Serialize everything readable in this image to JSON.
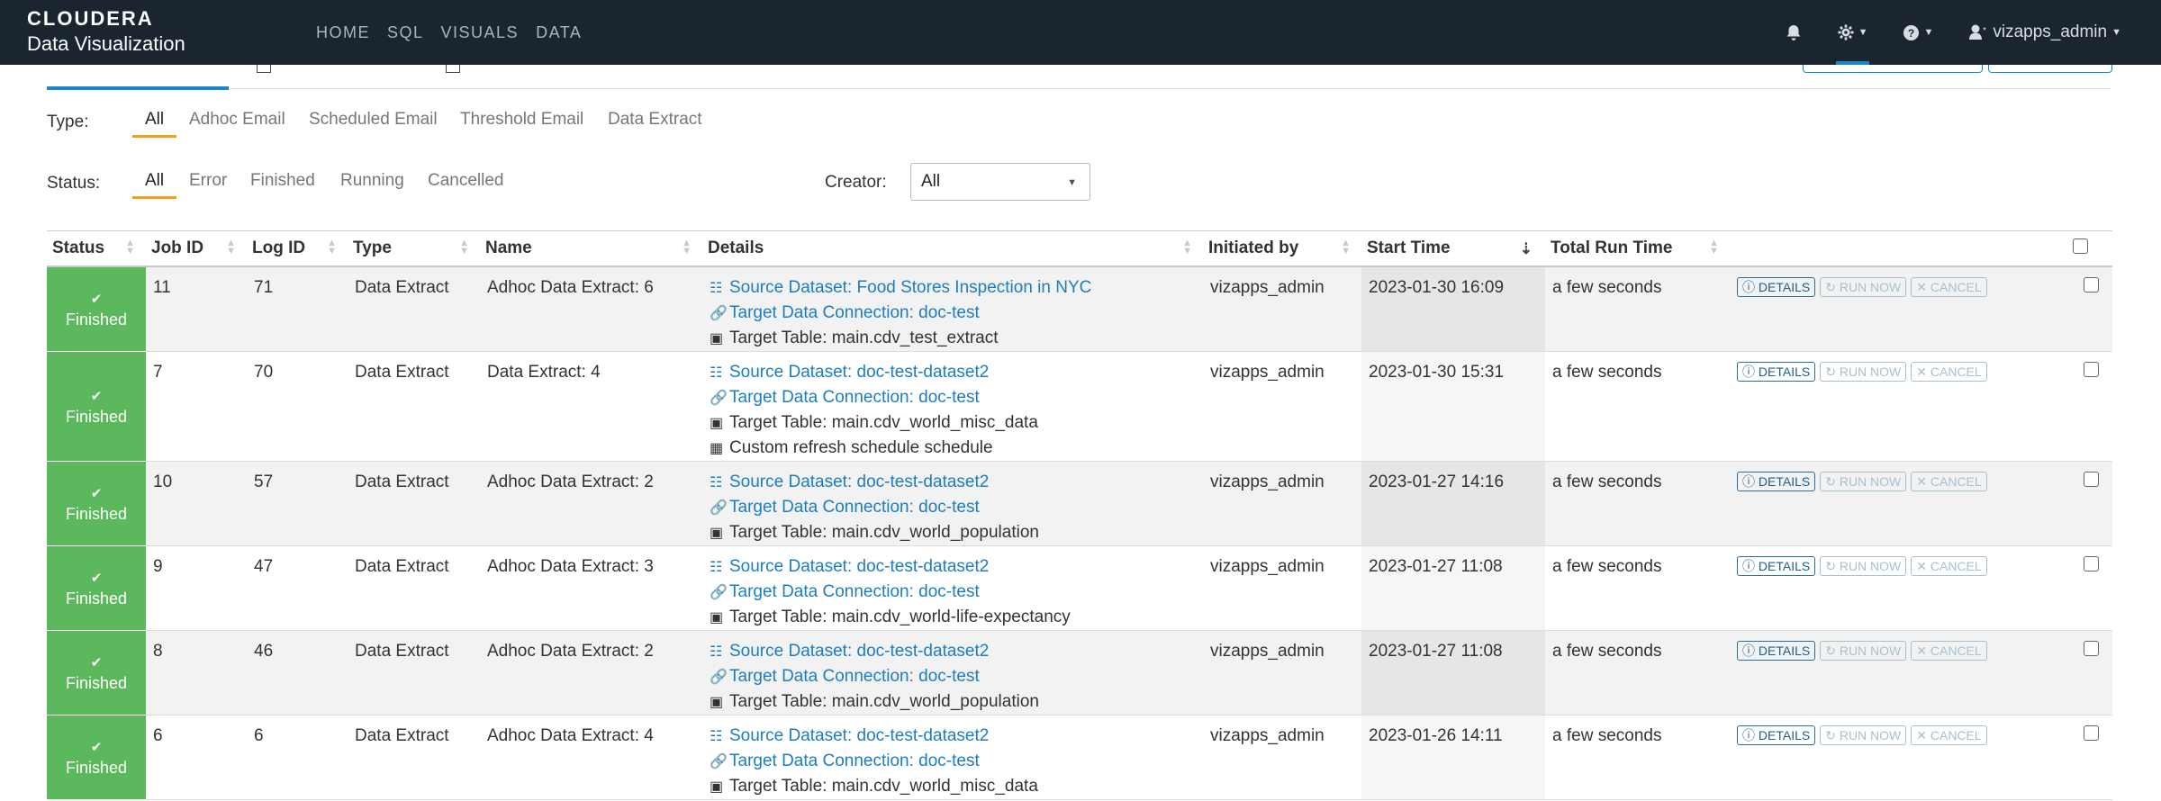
{
  "brand": {
    "top": "CLOUDERA",
    "bottom": "Data Visualization"
  },
  "nav": {
    "links": [
      "HOME",
      "SQL",
      "VISUALS",
      "DATA"
    ],
    "user": "vizapps_admin"
  },
  "filters": {
    "type_label": "Type:",
    "type_options": [
      "All",
      "Adhoc Email",
      "Scheduled Email",
      "Threshold Email",
      "Data Extract"
    ],
    "status_label": "Status:",
    "status_options": [
      "All",
      "Error",
      "Finished",
      "Running",
      "Cancelled"
    ],
    "creator_label": "Creator:",
    "creator_value": "All"
  },
  "table": {
    "headers": [
      "Status",
      "Job ID",
      "Log ID",
      "Type",
      "Name",
      "Details",
      "Initiated by",
      "Start Time",
      "Total Run Time"
    ],
    "buttons": {
      "details": "DETAILS",
      "run_now": "RUN NOW",
      "cancel": "CANCEL"
    },
    "rows": [
      {
        "status": "Finished",
        "job_id": "11",
        "log_id": "71",
        "type": "Data Extract",
        "name": "Adhoc Data Extract: 6",
        "source": "Source Dataset: Food Stores Inspection in NYC",
        "connection": "Target Data Connection: doc-test",
        "target": "Target Table: main.cdv_test_extract",
        "schedule": "",
        "initiated_by": "vizapps_admin",
        "start_time": "2023-01-30 16:09",
        "run_time": "a few seconds"
      },
      {
        "status": "Finished",
        "job_id": "7",
        "log_id": "70",
        "type": "Data Extract",
        "name": "Data Extract: 4",
        "source": "Source Dataset: doc-test-dataset2",
        "connection": "Target Data Connection: doc-test",
        "target": "Target Table: main.cdv_world_misc_data",
        "schedule": "Custom refresh schedule schedule",
        "initiated_by": "vizapps_admin",
        "start_time": "2023-01-30 15:31",
        "run_time": "a few seconds"
      },
      {
        "status": "Finished",
        "job_id": "10",
        "log_id": "57",
        "type": "Data Extract",
        "name": "Adhoc Data Extract: 2",
        "source": "Source Dataset: doc-test-dataset2",
        "connection": "Target Data Connection: doc-test",
        "target": "Target Table: main.cdv_world_population",
        "schedule": "",
        "initiated_by": "vizapps_admin",
        "start_time": "2023-01-27 14:16",
        "run_time": "a few seconds"
      },
      {
        "status": "Finished",
        "job_id": "9",
        "log_id": "47",
        "type": "Data Extract",
        "name": "Adhoc Data Extract: 3",
        "source": "Source Dataset: doc-test-dataset2",
        "connection": "Target Data Connection: doc-test",
        "target": "Target Table: main.cdv_world-life-expectancy",
        "schedule": "",
        "initiated_by": "vizapps_admin",
        "start_time": "2023-01-27 11:08",
        "run_time": "a few seconds"
      },
      {
        "status": "Finished",
        "job_id": "8",
        "log_id": "46",
        "type": "Data Extract",
        "name": "Adhoc Data Extract: 2",
        "source": "Source Dataset: doc-test-dataset2",
        "connection": "Target Data Connection: doc-test",
        "target": "Target Table: main.cdv_world_population",
        "schedule": "",
        "initiated_by": "vizapps_admin",
        "start_time": "2023-01-27 11:08",
        "run_time": "a few seconds"
      },
      {
        "status": "Finished",
        "job_id": "6",
        "log_id": "6",
        "type": "Data Extract",
        "name": "Adhoc Data Extract: 4",
        "source": "Source Dataset: doc-test-dataset2",
        "connection": "Target Data Connection: doc-test",
        "target": "Target Table: main.cdv_world_misc_data",
        "schedule": "",
        "initiated_by": "vizapps_admin",
        "start_time": "2023-01-26 14:11",
        "run_time": "a few seconds"
      }
    ]
  },
  "colors": {
    "navbar": "#1a2530",
    "accent_blue": "#1b86c7",
    "filter_underline": "#f0a01e",
    "status_finished": "#5cb85c",
    "link": "#1b7ec2"
  }
}
